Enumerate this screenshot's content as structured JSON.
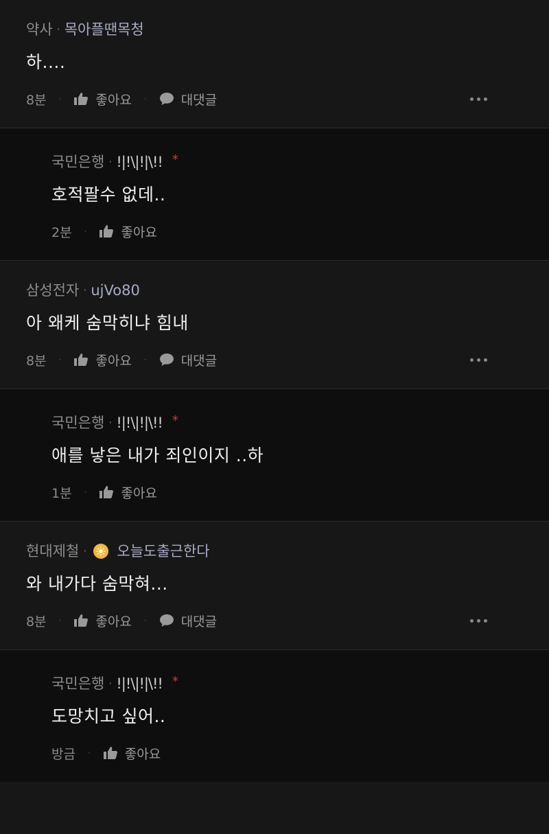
{
  "comments": [
    {
      "type": "top",
      "company": "약사",
      "nickname": "목아플땐목청",
      "body": "하....",
      "time": "8분",
      "like_label": "좋아요",
      "reply_label": "대댓글"
    },
    {
      "type": "reply",
      "company": "국민은행",
      "nickname": "!|!\\|!|\\!!",
      "writer_mark": "*",
      "body": "호적팔수 없데..",
      "time": "2분",
      "like_label": "좋아요"
    },
    {
      "type": "top",
      "company": "삼성전자",
      "nickname": "ujVo80",
      "body": "아 왜케 숨막히냐 힘내",
      "time": "8분",
      "like_label": "좋아요",
      "reply_label": "대댓글"
    },
    {
      "type": "reply",
      "company": "국민은행",
      "nickname": "!|!\\|!|\\!!",
      "writer_mark": "*",
      "body": "애를 낳은 내가 죄인이지 ..하",
      "time": "1분",
      "like_label": "좋아요"
    },
    {
      "type": "top",
      "company": "현대제철",
      "nickname": "오늘도출근한다",
      "has_badge": true,
      "body": "와 내가다 숨막혀...",
      "time": "8분",
      "like_label": "좋아요",
      "reply_label": "대댓글"
    },
    {
      "type": "reply",
      "company": "국민은행",
      "nickname": "!|!\\|!|\\!!",
      "writer_mark": "*",
      "body": "도망치고 싶어..",
      "time": "방금",
      "like_label": "좋아요"
    }
  ],
  "separator": "·",
  "icons": {
    "like": "thumbs-up-icon",
    "reply": "speech-bubble-icon",
    "more": "more-dots-icon",
    "badge": "company-badge-icon"
  },
  "colors": {
    "background": "#171717",
    "reply_background": "#0e0e0e",
    "nickname": "#a9abc4",
    "writer_mark": "#e0343a",
    "badge": "#f0b83d"
  }
}
